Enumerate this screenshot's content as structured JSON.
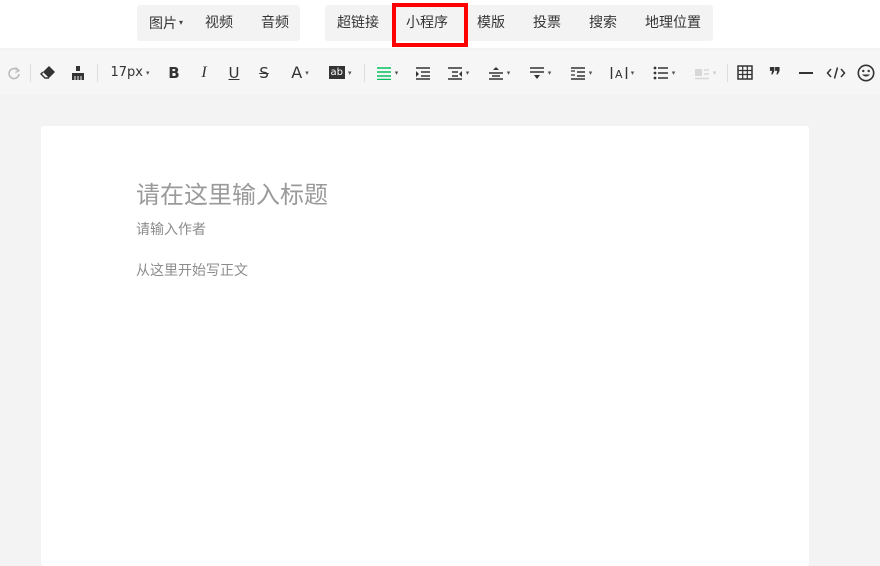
{
  "insert_menu": {
    "group1": [
      {
        "label": "图片",
        "has_dropdown": true
      },
      {
        "label": "视频"
      },
      {
        "label": "音频"
      }
    ],
    "group2": [
      {
        "label": "超链接"
      },
      {
        "label": "小程序",
        "highlighted": true
      },
      {
        "label": "模版"
      },
      {
        "label": "投票"
      },
      {
        "label": "搜索"
      },
      {
        "label": "地理位置"
      }
    ],
    "highlight_color": "#ff0000"
  },
  "format_toolbar": {
    "font_size": "17px",
    "bold_label": "B",
    "italic_label": "I",
    "underline_label": "U",
    "strike_label": "S",
    "font_color_label": "A",
    "bg_color_label": "ab",
    "quote_label": "❞",
    "accent_color": "#07c160",
    "icons": [
      "redo-icon",
      "eraser-icon",
      "format-painter-icon",
      "font-size-select",
      "bold-icon",
      "italic-icon",
      "underline-icon",
      "strikethrough-icon",
      "font-color-icon",
      "background-color-icon",
      "align-icon",
      "indent-icon",
      "first-line-indent-icon",
      "line-height-icon",
      "paragraph-spacing-icon",
      "spacing-icon",
      "letter-spacing-icon",
      "list-icon",
      "image-float-icon",
      "table-icon",
      "quote-icon",
      "divider-icon",
      "code-icon",
      "emoji-icon"
    ]
  },
  "editor": {
    "title_placeholder": "请在这里输入标题",
    "author_placeholder": "请输入作者",
    "body_placeholder": "从这里开始写正文"
  }
}
